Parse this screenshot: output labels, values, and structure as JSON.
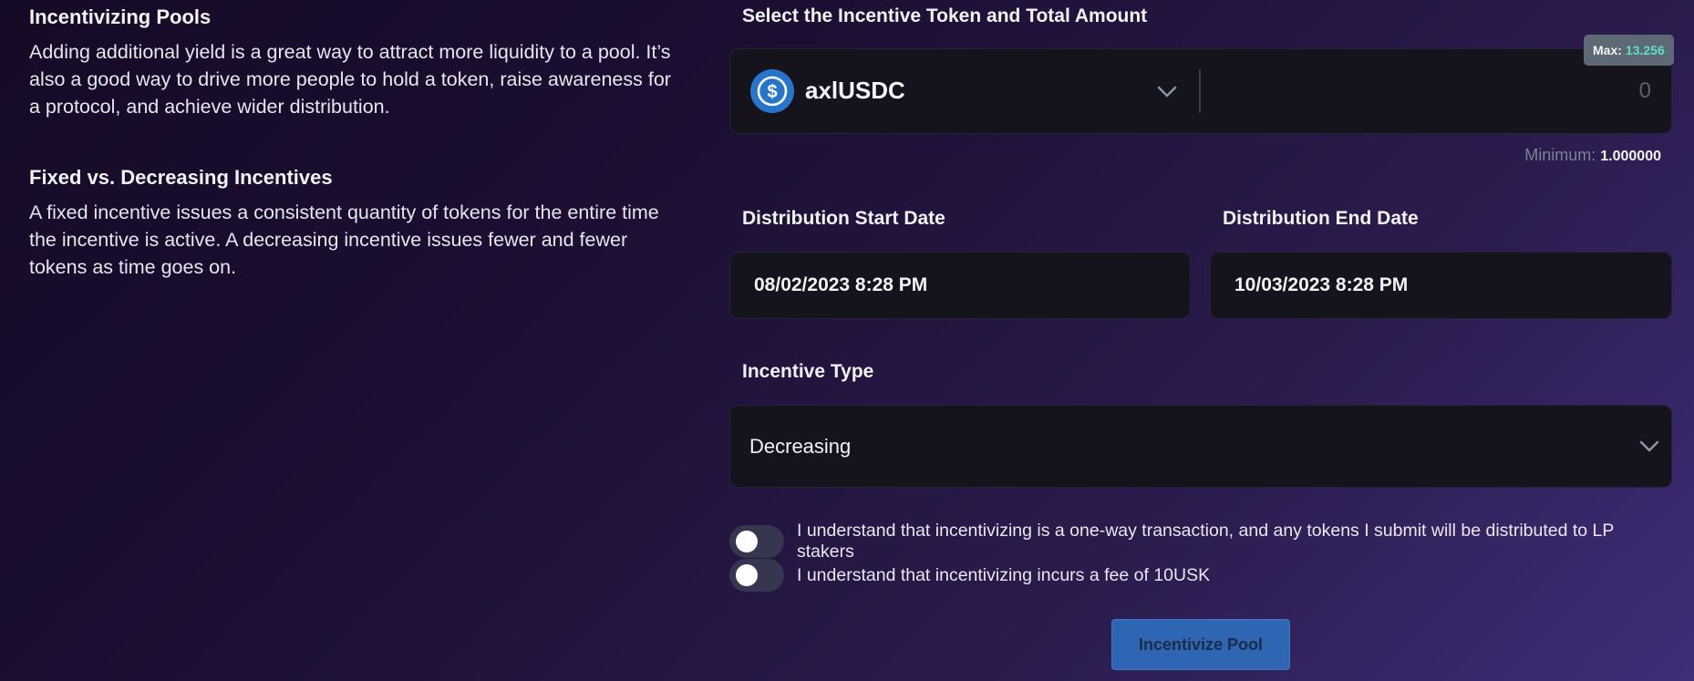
{
  "info": {
    "incentivizing_title": "Incentivizing Pools",
    "incentivizing_text": "Adding additional yield is a great way to attract more liquidity to a pool. It’s also a good way to drive more people to hold a token, raise awareness for a protocol, and achieve wider distribution.",
    "fixed_title": "Fixed vs. Decreasing Incentives",
    "fixed_text": "A fixed incentive issues a consistent quantity of tokens for the entire time the incentive is active. A decreasing incentive issues fewer and fewer tokens as time goes on."
  },
  "token": {
    "section_label": "Select the Incentive Token and Total Amount",
    "name": "axlUSDC",
    "amount_placeholder": "0",
    "max_label": "Max:",
    "max_value": "13.256",
    "minimum_label": "Minimum:",
    "minimum_value": "1.000000",
    "icon": "usdc-token-icon",
    "brand_color": "#2775ca"
  },
  "dates": {
    "start_label": "Distribution Start Date",
    "start_value": "08/02/2023 8:28 PM",
    "end_label": "Distribution End Date",
    "end_value": "10/03/2023 8:28 PM"
  },
  "incentive_type": {
    "label": "Incentive Type",
    "selected": "Decreasing"
  },
  "agreements": [
    {
      "text": "I understand that incentivizing is a one-way transaction, and any tokens I submit will be distributed to LP stakers",
      "checked": false
    },
    {
      "text": "I understand that incentivizing incurs a fee of 10USK",
      "checked": false
    }
  ],
  "submit_label": "Incentivize Pool"
}
